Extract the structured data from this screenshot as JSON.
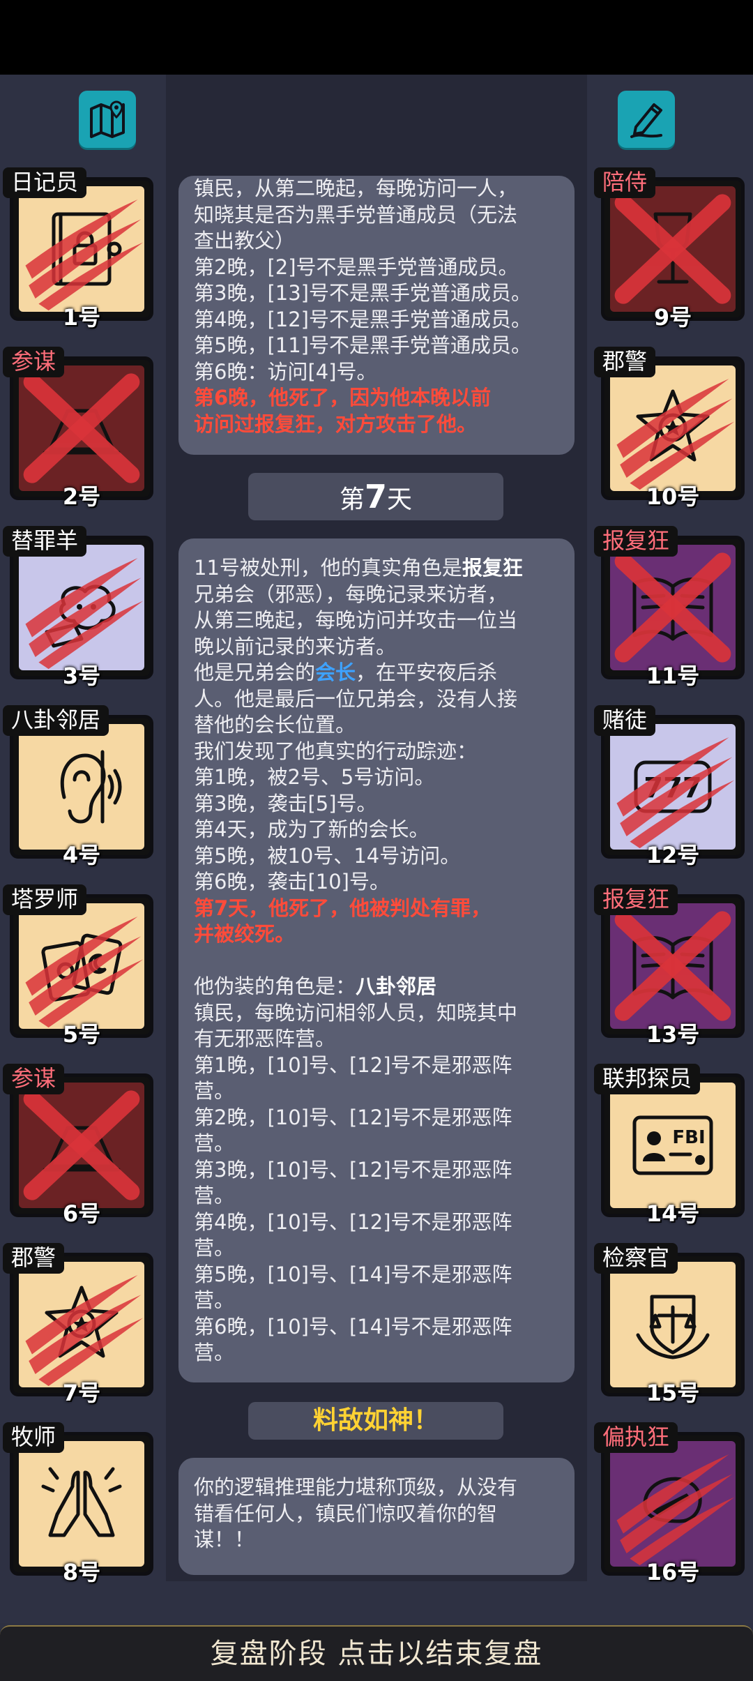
{
  "players_left": [
    {
      "num": "1号",
      "role": "日记员",
      "role_red": false,
      "bg": "beige",
      "icon": "diary-lock-icon",
      "dead": "scratch"
    },
    {
      "num": "2号",
      "role": "参谋",
      "role_red": true,
      "bg": "maroon",
      "icon": "hat-icon",
      "dead": "x"
    },
    {
      "num": "3号",
      "role": "替罪羊",
      "role_red": false,
      "bg": "lav",
      "icon": "sheep-icon",
      "dead": "scratch"
    },
    {
      "num": "4号",
      "role": "八卦邻居",
      "role_red": false,
      "bg": "beige",
      "icon": "ear-icon",
      "dead": "none"
    },
    {
      "num": "5号",
      "role": "塔罗师",
      "role_red": false,
      "bg": "beige",
      "icon": "tarot-cards-icon",
      "dead": "scratch"
    },
    {
      "num": "6号",
      "role": "参谋",
      "role_red": true,
      "bg": "maroon",
      "icon": "hat-icon",
      "dead": "x"
    },
    {
      "num": "7号",
      "role": "郡警",
      "role_red": false,
      "bg": "beige",
      "icon": "sheriff-badge-icon",
      "dead": "scratch"
    },
    {
      "num": "8号",
      "role": "牧师",
      "role_red": false,
      "bg": "beige",
      "icon": "praying-hands-icon",
      "dead": "none"
    }
  ],
  "players_right": [
    {
      "num": "9号",
      "role": "陪侍",
      "role_red": true,
      "bg": "maroon",
      "icon": "wine-glass-icon",
      "dead": "x"
    },
    {
      "num": "10号",
      "role": "郡警",
      "role_red": false,
      "bg": "beige",
      "icon": "sheriff-badge-icon",
      "dead": "scratch"
    },
    {
      "num": "11号",
      "role": "报复狂",
      "role_red": true,
      "bg": "purple",
      "icon": "book-icon",
      "dead": "x"
    },
    {
      "num": "12号",
      "role": "赌徒",
      "role_red": false,
      "bg": "lav",
      "icon": "slot-777-icon",
      "dead": "scratch"
    },
    {
      "num": "13号",
      "role": "报复狂",
      "role_red": true,
      "bg": "purple",
      "icon": "book-icon",
      "dead": "x"
    },
    {
      "num": "14号",
      "role": "联邦探员",
      "role_red": false,
      "bg": "beige",
      "icon": "fbi-card-icon",
      "dead": "none"
    },
    {
      "num": "15号",
      "role": "检察官",
      "role_red": false,
      "bg": "beige",
      "icon": "justice-scales-icon",
      "dead": "none"
    },
    {
      "num": "16号",
      "role": "偏执狂",
      "role_red": true,
      "bg": "purple",
      "icon": "knife-icon",
      "dead": "scratch"
    }
  ],
  "log_top": [
    "镇民，从第二晚起，每晚访问一人，",
    "知晓其是否为黑手党普通成员（无法",
    "查出教父）",
    "第2晚，[2]号不是黑手党普通成员。",
    "第3晚，[13]号不是黑手党普通成员。",
    "第4晚，[12]号不是黑手党普通成员。",
    "第5晚，[11]号不是黑手党普通成员。",
    "第6晚：访问[4]号。"
  ],
  "log_top_highlight": [
    "第6晚，他死了，因为他本晚以前",
    "访问过报复狂，对方攻击了他。"
  ],
  "day_label": {
    "prefix": "第",
    "num": "7",
    "suffix": "天"
  },
  "log_main": {
    "line1_a": "11号被处刑，他的真实角色是",
    "line1_b": "报复狂",
    "lines_a": [
      "兄弟会（邪恶），每晚记录来访者，",
      "从第三晚起，每晚访问并攻击一位当",
      "晚以前记录的来访者。"
    ],
    "line5_a": "他是兄弟会的",
    "line5_b": "会长",
    "line5_c": "，在平安夜后杀",
    "lines_b": [
      "人。他是最后一位兄弟会，没有人接",
      "替他的会长位置。",
      "我们发现了他真实的行动踪迹：",
      "第1晚，被2号、5号访问。",
      "第3晚，袭击[5]号。",
      "第4天，成为了新的会长。",
      "第5晚，被10号、14号访问。",
      "第6晚，袭击[10]号。"
    ],
    "highlight": [
      "第7天，他死了，他被判处有罪，",
      "并被绞死。"
    ],
    "disguise_a": "他伪装的角色是：",
    "disguise_b": "八卦邻居",
    "lines_c": [
      "镇民，每晚访问相邻人员，知晓其中",
      "有无邪恶阵营。",
      "第1晚，[10]号、[12]号不是邪恶阵",
      "营。",
      "第2晚，[10]号、[12]号不是邪恶阵",
      "营。",
      "第3晚，[10]号、[12]号不是邪恶阵",
      "营。",
      "第4晚，[10]号、[12]号不是邪恶阵",
      "营。",
      "第5晚，[10]号、[14]号不是邪恶阵",
      "营。",
      "第6晚，[10]号、[14]号不是邪恶阵",
      "营。"
    ]
  },
  "verdict": "料敌如神！",
  "summary": [
    "你的逻辑推理能力堪称顶级，从没有",
    "错看任何人，镇民们惊叹着你的智",
    "谋！！"
  ],
  "footer": "复盘阶段 点击以结束复盘",
  "tools": {
    "left": "map-icon",
    "right": "edit-pen-icon"
  },
  "colors": {
    "accent_red": "#ff4b3a",
    "accent_blue": "#3ea2ff",
    "verdict_yellow": "#ffd233",
    "button_teal": "#1aa3b3"
  }
}
